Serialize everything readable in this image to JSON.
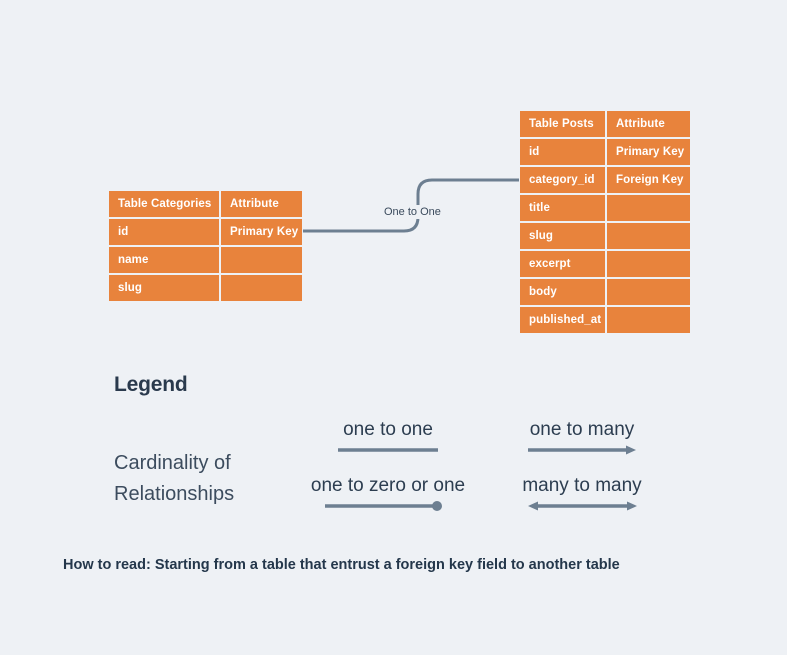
{
  "background_color": "#eef1f5",
  "accent_color": "#e8833c",
  "line_color": "#6d7f91",
  "text_color": "#2c3d50",
  "diagram": {
    "tables": [
      {
        "id": "categories",
        "header": {
          "name": "Table Categories",
          "attribute": "Attribute"
        },
        "rows": [
          {
            "field": "id",
            "attribute": "Primary Key"
          },
          {
            "field": "name",
            "attribute": ""
          },
          {
            "field": "slug",
            "attribute": ""
          }
        ]
      },
      {
        "id": "posts",
        "header": {
          "name": "Table Posts",
          "attribute": "Attribute"
        },
        "rows": [
          {
            "field": "id",
            "attribute": "Primary Key"
          },
          {
            "field": "category_id",
            "attribute": "Foreign Key"
          },
          {
            "field": "title",
            "attribute": ""
          },
          {
            "field": "slug",
            "attribute": ""
          },
          {
            "field": "excerpt",
            "attribute": ""
          },
          {
            "field": "body",
            "attribute": ""
          },
          {
            "field": "published_at",
            "attribute": ""
          }
        ]
      }
    ],
    "relationship": {
      "label": "One to One",
      "from": "categories.id",
      "to": "posts.category_id"
    }
  },
  "legend": {
    "title": "Legend",
    "subject": "Cardinality of Relationships",
    "items": [
      {
        "label": "one to one",
        "symbol": "plain-line"
      },
      {
        "label": "one to many",
        "symbol": "line-arrow-right"
      },
      {
        "label": "one to zero or one",
        "symbol": "line-dot-right"
      },
      {
        "label": "many to many",
        "symbol": "line-arrow-both"
      }
    ]
  },
  "caption": {
    "text": "How to read: Starting from a table that entrust a foreign key field to another table"
  }
}
